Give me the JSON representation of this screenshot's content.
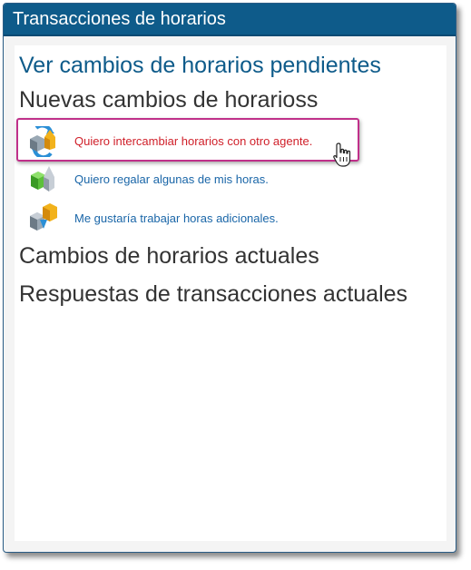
{
  "window": {
    "title": "Transacciones de horarios"
  },
  "main": {
    "pending_link": "Ver cambios de horarios pendientes",
    "new_changes_heading": "Nuevas cambios de horarioss",
    "options": [
      {
        "label": "Quiero intercambiar horarios con otro agente.",
        "icon": "swap-schedule-icon",
        "active": true
      },
      {
        "label": "Quiero regalar algunas de mis horas.",
        "icon": "give-hours-icon",
        "active": false
      },
      {
        "label": "Me gustaría trabajar horas adicionales.",
        "icon": "extra-hours-icon",
        "active": false
      }
    ],
    "current_changes_heading": "Cambios de horarios actuales",
    "current_responses_heading": "Respuestas de transacciones actuales"
  },
  "colors": {
    "titlebar": "#0e5b8a",
    "link": "#0e5b8a",
    "option_link": "#1a66a8",
    "option_active": "#d0202a",
    "highlight": "#c0308a"
  }
}
